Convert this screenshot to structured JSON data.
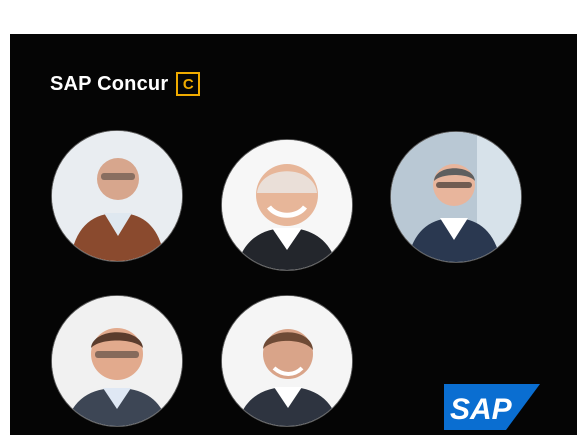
{
  "brand": {
    "name": "SAP Concur",
    "mark_letter": "C"
  },
  "portraits": [
    {
      "icon": "person-portrait",
      "suit": "#8a4a2e",
      "shirt": "#dfe8f0"
    },
    {
      "icon": "person-portrait",
      "suit": "#23262c",
      "shirt": "#ffffff"
    },
    {
      "icon": "person-portrait",
      "suit": "#2a3850",
      "shirt": "#ffffff"
    },
    {
      "icon": "person-portrait",
      "suit": "#3d4655",
      "shirt": "#dfe8f4"
    },
    {
      "icon": "person-portrait",
      "suit": "#2e3440",
      "shirt": "#ffffff"
    }
  ],
  "footer_logo": {
    "text": "SAP",
    "color": "#0a6ed1"
  },
  "colors": {
    "panel_background": "#050505",
    "brand_accent": "#f0ab00"
  }
}
